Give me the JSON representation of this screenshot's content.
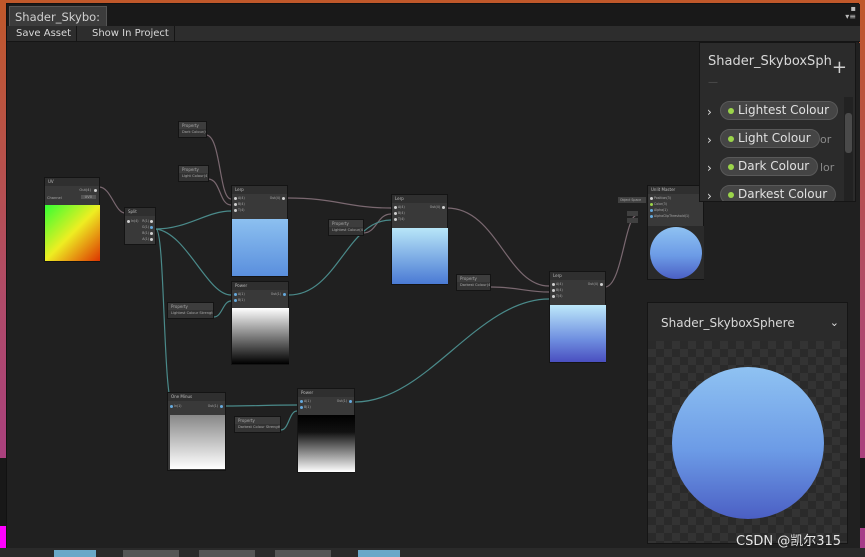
{
  "window": {
    "tab_title": "Shader_Skybo:",
    "toolbar": {
      "save_asset": "Save Asset",
      "show_in_project": "Show In Project"
    }
  },
  "blackboard": {
    "title": "Shader_SkyboxSph",
    "subtitle": "—",
    "add_label": "+",
    "properties": [
      {
        "label": "Lightest Colour",
        "tail": ""
      },
      {
        "label": "Light Colour",
        "tail": "or"
      },
      {
        "label": "Dark Colour",
        "tail": "lor"
      },
      {
        "label": "Darkest Colour",
        "tail": ""
      }
    ]
  },
  "main_preview": {
    "title": "Shader_SkyboxSphere",
    "chevron": "⌄"
  },
  "watermark": "CSDN @凯尔315",
  "colors": {
    "accent_port_green": "#9bd54a",
    "sphere_top": "#8fc2f2",
    "sphere_bottom": "#4b5fc4",
    "wire_color": "#7a6870",
    "wire_vector": "#4a8a8a"
  },
  "nodes": {
    "uv": {
      "title": "UV",
      "out": "Out(4)",
      "channel": "Channel",
      "channel_value": "UV0"
    },
    "split": {
      "title": "Split",
      "in": "In(4)",
      "outs": [
        "R(1)",
        "G(1)",
        "B(1)",
        "A(1)"
      ]
    },
    "lerp1": {
      "title": "Lerp",
      "ins": [
        "A(4)",
        "B(4)",
        "T(4)"
      ],
      "out": "Out(4)"
    },
    "lerp2": {
      "title": "Lerp",
      "ins": [
        "A(4)",
        "B(4)",
        "T(4)"
      ],
      "out": "Out(4)"
    },
    "lerp3": {
      "title": "Lerp",
      "ins": [
        "A(4)",
        "B(4)",
        "T(4)"
      ],
      "out": "Out(4)"
    },
    "power1": {
      "title": "Power",
      "ins": [
        "A(1)",
        "B(1)"
      ],
      "out": "Out(1)"
    },
    "power2": {
      "title": "Power",
      "ins": [
        "A(1)",
        "B(1)"
      ],
      "out": "Out(1)"
    },
    "oneminus": {
      "title": "One Minus",
      "in": "In(1)",
      "out": "Out(1)"
    },
    "unlit_master": {
      "title": "Unlit Master",
      "ins": [
        "Position(3)",
        "Color(3)",
        "Alpha(1)",
        "AlphaClipThreshold(1)"
      ],
      "vertex_label": "Object Space"
    },
    "props": [
      {
        "title": "Property",
        "value": "Dark Colour(4)"
      },
      {
        "title": "Property",
        "value": "Light Colour(4)"
      },
      {
        "title": "Property",
        "value": "Lightest Colour(4)"
      },
      {
        "title": "Property",
        "value": "Darkest Colour(4)"
      },
      {
        "title": "Property",
        "value": "Lightest Colour Strength(1)"
      },
      {
        "title": "Property",
        "value": "Darkest Colour Strength(1)"
      }
    ]
  }
}
